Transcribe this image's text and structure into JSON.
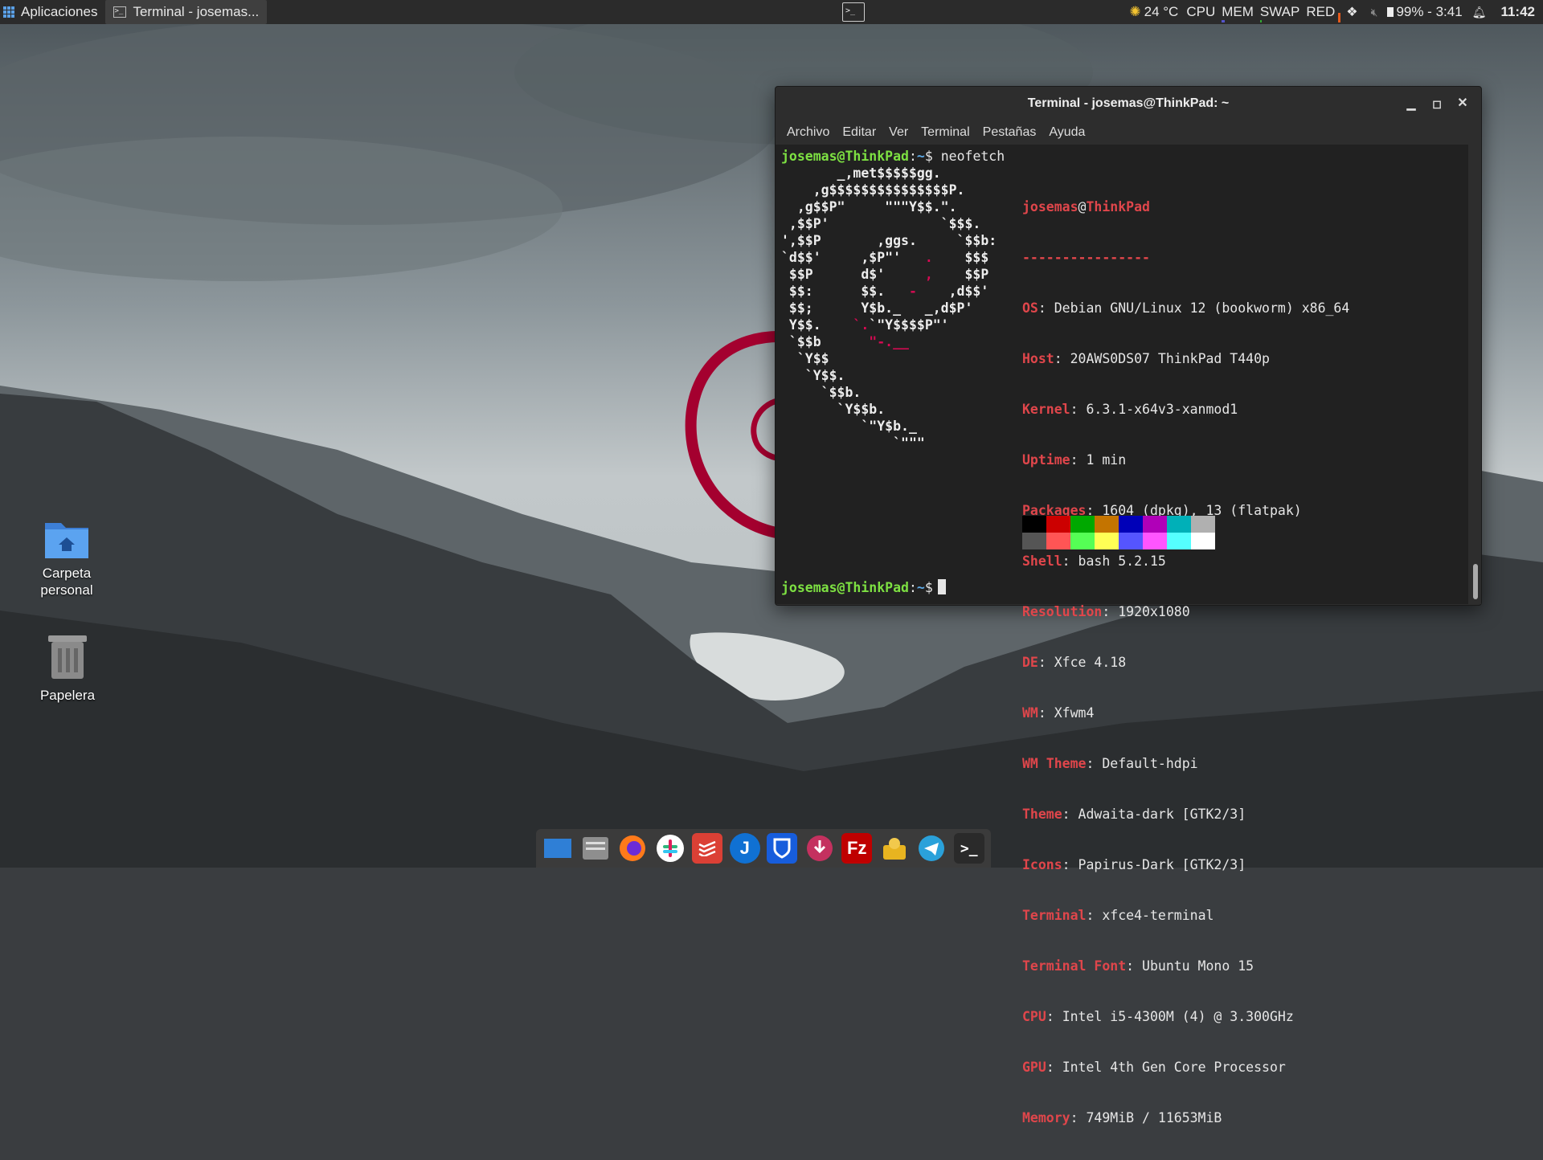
{
  "panel": {
    "applications_label": "Aplicaciones",
    "taskbar_item": "Terminal - josemas...",
    "weather": "24 °C",
    "monitors": [
      "CPU",
      "MEM",
      "SWAP",
      "RED"
    ],
    "battery": "99% - 3:41",
    "clock": "11:42"
  },
  "desktop": {
    "home_label_1": "Carpeta",
    "home_label_2": "personal",
    "trash_label": "Papelera"
  },
  "terminal": {
    "title": "Terminal - josemas@ThinkPad: ~",
    "menu": [
      "Archivo",
      "Editar",
      "Ver",
      "Terminal",
      "Pestañas",
      "Ayuda"
    ],
    "prompt_user": "josemas@ThinkPad",
    "prompt_sep": ":",
    "prompt_path": "~",
    "prompt_symbol": "$",
    "command": "neofetch",
    "info_user": "josemas",
    "info_at": "@",
    "info_host": "ThinkPad",
    "info_divider": "----------------",
    "info": [
      {
        "key": "OS",
        "value": "Debian GNU/Linux 12 (bookworm) x86_64"
      },
      {
        "key": "Host",
        "value": "20AWS0DS07 ThinkPad T440p"
      },
      {
        "key": "Kernel",
        "value": "6.3.1-x64v3-xanmod1"
      },
      {
        "key": "Uptime",
        "value": "1 min"
      },
      {
        "key": "Packages",
        "value": "1604 (dpkg), 13 (flatpak)"
      },
      {
        "key": "Shell",
        "value": "bash 5.2.15"
      },
      {
        "key": "Resolution",
        "value": "1920x1080"
      },
      {
        "key": "DE",
        "value": "Xfce 4.18"
      },
      {
        "key": "WM",
        "value": "Xfwm4"
      },
      {
        "key": "WM Theme",
        "value": "Default-hdpi"
      },
      {
        "key": "Theme",
        "value": "Adwaita-dark [GTK2/3]"
      },
      {
        "key": "Icons",
        "value": "Papirus-Dark [GTK2/3]"
      },
      {
        "key": "Terminal",
        "value": "xfce4-terminal"
      },
      {
        "key": "Terminal Font",
        "value": "Ubuntu Mono 15"
      },
      {
        "key": "CPU",
        "value": "Intel i5-4300M (4) @ 3.300GHz"
      },
      {
        "key": "GPU",
        "value": "Intel 4th Gen Core Processor"
      },
      {
        "key": "Memory",
        "value": "749MiB / 11653MiB"
      }
    ],
    "palette": [
      "#000000",
      "#cc0000",
      "#00a800",
      "#c47400",
      "#0000b8",
      "#b000b8",
      "#00b0b8",
      "#b0b0b0",
      "#555555",
      "#ff5555",
      "#55ff55",
      "#ffff55",
      "#5555ff",
      "#ff55ff",
      "#55ffff",
      "#ffffff"
    ]
  },
  "dock": [
    "desktop-icon",
    "files-icon",
    "firefox-icon",
    "slack-icon",
    "todoist-icon",
    "joplin-icon",
    "bitwarden-icon",
    "downloader-icon",
    "filezilla-icon",
    "maintenance-icon",
    "telegram-icon",
    "terminal-icon"
  ],
  "colors": {
    "accent_green": "#7de042",
    "accent_blue": "#5da9e6",
    "info_red": "#e0464b",
    "debian_red": "#a4002f"
  }
}
